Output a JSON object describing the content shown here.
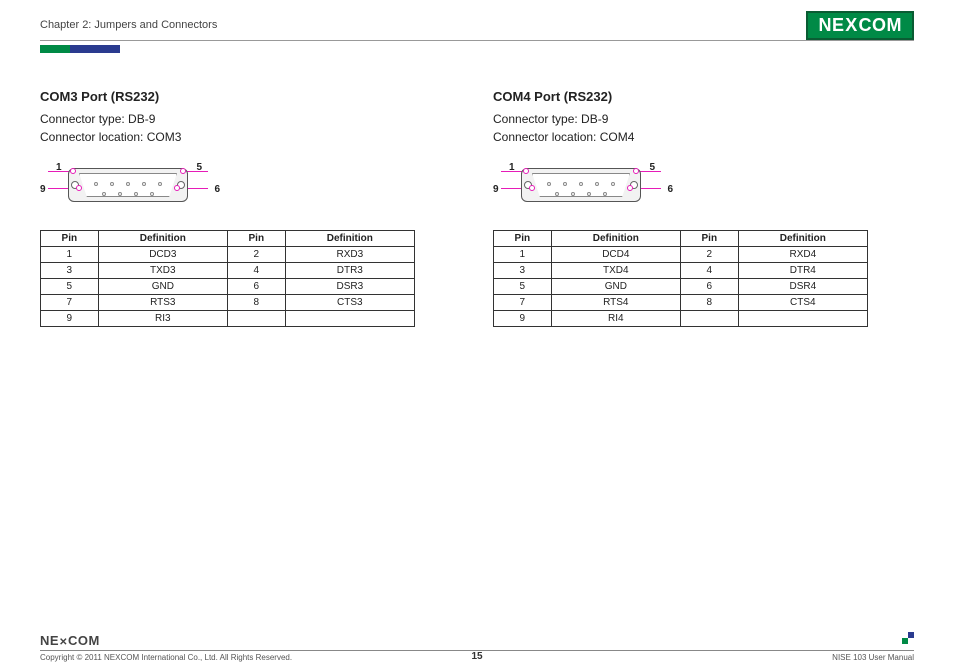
{
  "header": {
    "chapter": "Chapter 2: Jumpers and Connectors",
    "logo_text": "NEXCOM"
  },
  "sections": [
    {
      "title": "COM3 Port (RS232)",
      "type_line": "Connector type: DB-9",
      "loc_line": "Connector location: COM3",
      "pin_labels": {
        "tl": "1",
        "tr": "5",
        "bl": "9",
        "br": "6"
      },
      "table": {
        "headers": [
          "Pin",
          "Definition",
          "Pin",
          "Definition"
        ],
        "rows": [
          [
            "1",
            "DCD3",
            "2",
            "RXD3"
          ],
          [
            "3",
            "TXD3",
            "4",
            "DTR3"
          ],
          [
            "5",
            "GND",
            "6",
            "DSR3"
          ],
          [
            "7",
            "RTS3",
            "8",
            "CTS3"
          ],
          [
            "9",
            "RI3",
            "",
            ""
          ]
        ]
      }
    },
    {
      "title": "COM4 Port (RS232)",
      "type_line": "Connector type: DB-9",
      "loc_line": "Connector location: COM4",
      "pin_labels": {
        "tl": "1",
        "tr": "5",
        "bl": "9",
        "br": "6"
      },
      "table": {
        "headers": [
          "Pin",
          "Definition",
          "Pin",
          "Definition"
        ],
        "rows": [
          [
            "1",
            "DCD4",
            "2",
            "RXD4"
          ],
          [
            "3",
            "TXD4",
            "4",
            "DTR4"
          ],
          [
            "5",
            "GND",
            "6",
            "DSR4"
          ],
          [
            "7",
            "RTS4",
            "8",
            "CTS4"
          ],
          [
            "9",
            "RI4",
            "",
            ""
          ]
        ]
      }
    }
  ],
  "footer": {
    "logo_text": "NEXCOM",
    "copyright": "Copyright © 2011 NEXCOM International Co., Ltd. All Rights Reserved.",
    "page_num": "15",
    "doc_title": "NISE 103 User Manual"
  }
}
